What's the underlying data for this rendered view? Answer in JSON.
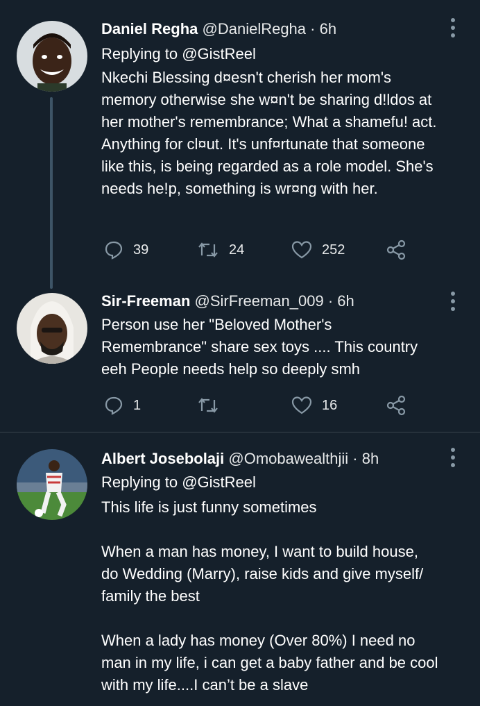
{
  "tweets": [
    {
      "name": "Daniel Regha",
      "handle": "@DanielRegha",
      "time": "6h",
      "replying_prefix": "Replying to",
      "replying_to": "@GistReel",
      "text": "Nkechi Blessing d¤esn't cherish her mom's memory otherwise she w¤n't be sharing d!ldos at her mother's remembrance; What a shamefu! act. Anything for cl¤ut. It's unf¤rtunate that someone like this, is being regarded as a role model. She's needs he!p, something is wr¤ng with her.",
      "replies": "39",
      "retweets": "24",
      "likes": "252"
    },
    {
      "name": "Sir-Freeman",
      "handle": "@SirFreeman_009",
      "time": "6h",
      "text": "Person use her \"Beloved Mother's Remembrance\" share sex toys .... This country eeh People needs help so deeply smh",
      "replies": "1",
      "retweets": "",
      "likes": "16"
    },
    {
      "name": "Albert Josebolaji",
      "handle": "@Omobawealthjii",
      "time": "8h",
      "replying_prefix": "Replying to",
      "replying_to": "@GistReel",
      "text": "This life is just funny sometimes\n\nWhen a man has money, I want to build house, do Wedding (Marry), raise kids and give myself/ family the best\n\nWhen a lady has money (Over 80%) I need no man in my life, i can get a baby father and be cool with my life....I can’t be a slave"
    }
  ],
  "separator": "·",
  "icons": {
    "reply": "reply-icon",
    "retweet": "retweet-icon",
    "like": "heart-icon",
    "share": "share-icon",
    "more": "more-vertical-icon"
  },
  "colors": {
    "background": "#15202b",
    "secondary_text": "#8899a6",
    "divider": "#38444d",
    "thread_line": "#3d5466"
  }
}
